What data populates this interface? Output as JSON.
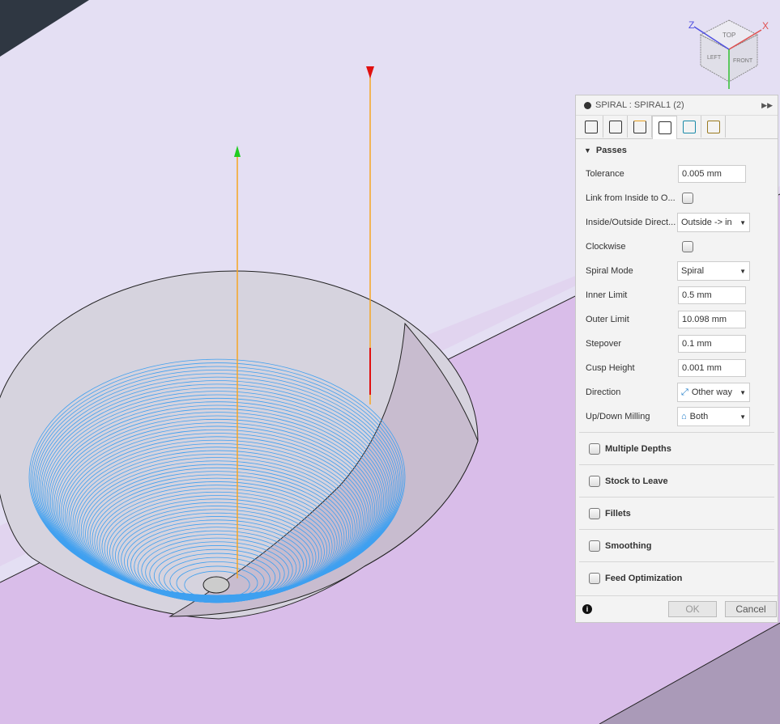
{
  "viewcube": {
    "faces": [
      "TOP",
      "LEFT",
      "FRONT"
    ],
    "axes": [
      "X",
      "Z"
    ]
  },
  "panel": {
    "title": "SPIRAL : SPIRAL1 (2)",
    "tabs": [
      "tool-icon",
      "geometry-icon",
      "heights-icon",
      "passes-icon",
      "linking-icon",
      "post-icon"
    ],
    "active_tab": 3,
    "section": "Passes",
    "fields": [
      {
        "label": "Tolerance",
        "type": "input",
        "value": "0.005 mm"
      },
      {
        "label": "Link from Inside to O...",
        "type": "checkbox",
        "checked": false
      },
      {
        "label": "Inside/Outside Direct...",
        "type": "select",
        "value": "Outside -> in"
      },
      {
        "label": "Clockwise",
        "type": "checkbox",
        "checked": false
      },
      {
        "label": "Spiral Mode",
        "type": "select",
        "value": "Spiral"
      },
      {
        "label": "Inner Limit",
        "type": "input",
        "value": "0.5 mm"
      },
      {
        "label": "Outer Limit",
        "type": "input",
        "value": "10.098 mm"
      },
      {
        "label": "Stepover",
        "type": "input",
        "value": "0.1 mm"
      },
      {
        "label": "Cusp Height",
        "type": "input",
        "value": "0.001 mm"
      },
      {
        "label": "Direction",
        "type": "select",
        "value": "Other way"
      },
      {
        "label": "Up/Down Milling",
        "type": "select",
        "value": "Both"
      }
    ],
    "groups": [
      "Multiple Depths",
      "Stock to Leave",
      "Fillets",
      "Smoothing",
      "Feed Optimization"
    ],
    "ok": "OK",
    "cancel": "Cancel"
  },
  "colors": {
    "toolpath": "#3fa0f0",
    "bg_top": "#e4dff3",
    "stock": "#d9bde9",
    "axis_orange": "#f5a623"
  }
}
